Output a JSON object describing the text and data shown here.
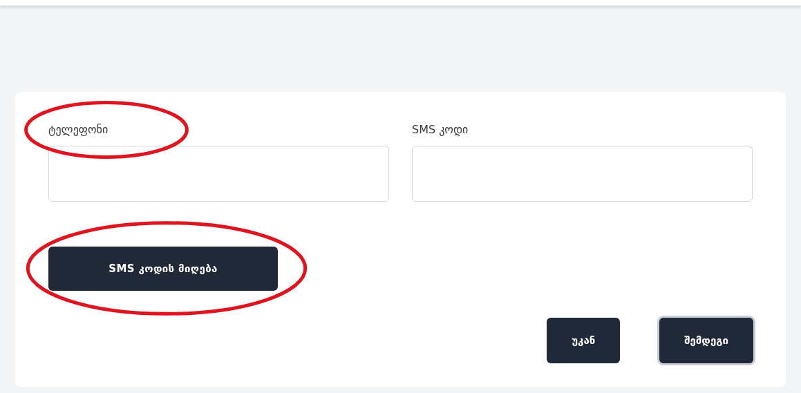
{
  "fields": [
    {
      "label": "ტელეფონი",
      "circled": true
    },
    {
      "label": "SMS კოდი",
      "circled": false
    }
  ],
  "get_code_button": {
    "label": "SMS კოდის მიღება",
    "circled": true
  },
  "buttons": [
    {
      "label": "უკან",
      "focused": false
    },
    {
      "label": "შემდეგი",
      "focused": true
    }
  ]
}
